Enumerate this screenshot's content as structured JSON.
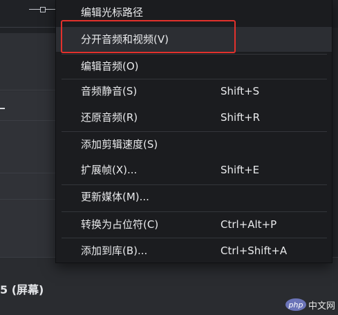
{
  "menu": {
    "items": [
      {
        "label": "编辑光标路径",
        "shortcut": ""
      },
      {
        "label": "分开音频和视频(V)",
        "shortcut": ""
      },
      {
        "label": "编辑音频(O)",
        "shortcut": ""
      },
      {
        "label": "音频静音(S)",
        "shortcut": "Shift+S"
      },
      {
        "label": "还原音频(R)",
        "shortcut": "Shift+R"
      },
      {
        "label": "添加剪辑速度(S)",
        "shortcut": ""
      },
      {
        "label": "扩展帧(X)...",
        "shortcut": "Shift+E"
      },
      {
        "label": "更新媒体(M)...",
        "shortcut": ""
      },
      {
        "label": "转换为占位符(C)",
        "shortcut": "Ctrl+Alt+P"
      },
      {
        "label": "添加到库(B)...",
        "shortcut": "Ctrl+Shift+A"
      }
    ],
    "highlighted_item": "分开音频和视频(V)"
  },
  "background": {
    "bottom_label": "5 (屏幕)"
  },
  "watermark": {
    "logo": "php",
    "text": "中文网"
  },
  "colors": {
    "menu_bg": "#1b1c1f",
    "highlight_border": "#e3312c",
    "text": "#e9eaec"
  }
}
